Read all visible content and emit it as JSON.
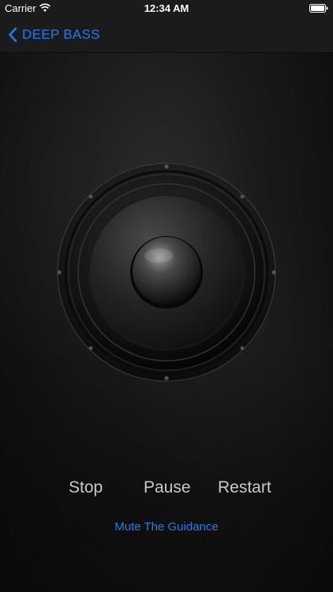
{
  "status_bar": {
    "carrier": "Carrier",
    "time": "12:34 AM",
    "wifi_icon": "wifi-icon",
    "battery_icon": "battery-icon"
  },
  "nav": {
    "back_label": "DEEP BASS",
    "back_icon": "chevron-left-icon",
    "accent_color": "#1e7cf2"
  },
  "speaker": {
    "icon": "speaker-icon"
  },
  "controls": {
    "stop": "Stop",
    "pause": "Pause",
    "restart": "Restart"
  },
  "mute_link": "Mute The Guidance"
}
